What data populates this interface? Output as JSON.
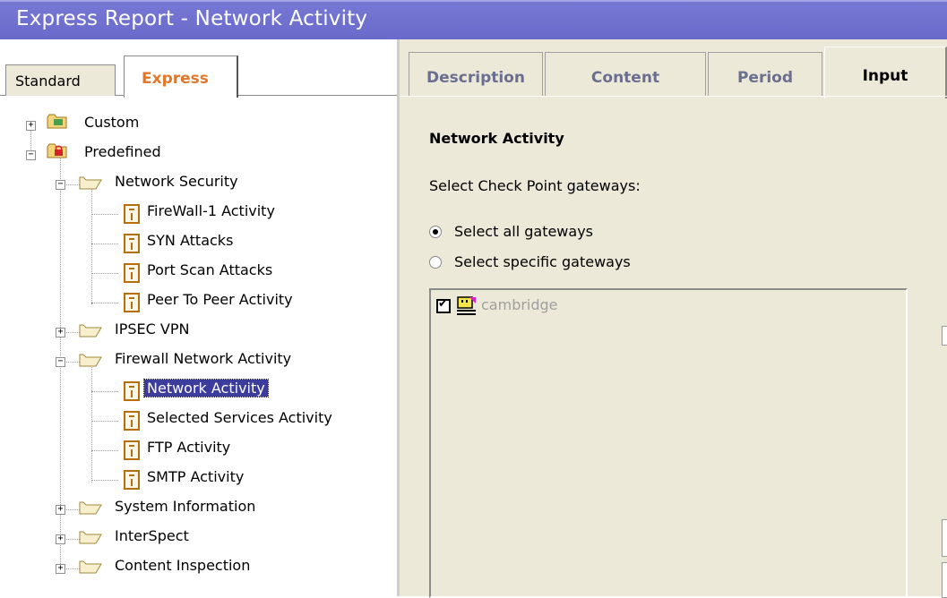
{
  "window": {
    "title": "Express Report - Network Activity"
  },
  "left_tabs": [
    {
      "label": "Standard"
    },
    {
      "label": "Express",
      "active": true
    }
  ],
  "tree": {
    "custom": "Custom",
    "predefined": "Predefined",
    "network_security": "Network Security",
    "ns_items": [
      "FireWall-1 Activity",
      "SYN Attacks",
      "Port Scan Attacks",
      "Peer To Peer Activity"
    ],
    "ipsec_vpn": "IPSEC VPN",
    "firewall_network_activity": "Firewall Network Activity",
    "fna_items": [
      "Network Activity",
      "Selected Services Activity",
      "FTP Activity",
      "SMTP Activity"
    ],
    "system_information": "System Information",
    "interspect": "InterSpect",
    "content_inspection": "Content Inspection"
  },
  "right_tabs": [
    {
      "label": "Description"
    },
    {
      "label": "Content"
    },
    {
      "label": "Period"
    },
    {
      "label": "Input",
      "active": true
    }
  ],
  "input": {
    "heading": "Network Activity",
    "prompt": "Select Check Point gateways:",
    "radio_all": "Select all gateways",
    "radio_specific": "Select specific gateways",
    "selected_radio": "Select all gateways",
    "gateways": [
      {
        "name": "cambridge",
        "checked": true
      }
    ]
  },
  "colors": {
    "title_bar": "#6a6acb",
    "selection": "#3c3c9c",
    "express_tab_text": "#e0782e",
    "panel_bg": "#ece9d8"
  }
}
